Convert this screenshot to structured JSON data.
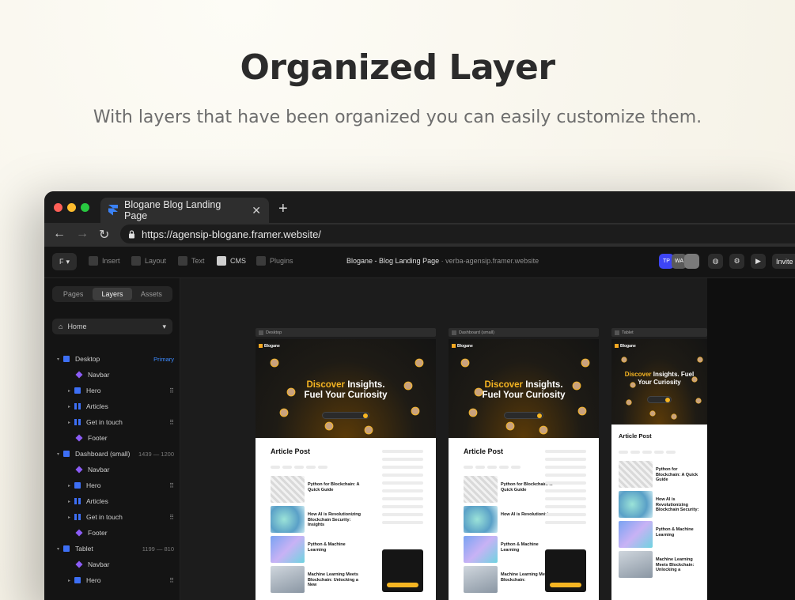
{
  "hero": {
    "title": "Organized Layer",
    "subtitle": "With layers that have been organized you can easily customize them."
  },
  "browser": {
    "tab_title": "Blogane Blog Landing Page",
    "url": "https://agensip-blogane.framer.website/",
    "traffic_colors": [
      "#fe5f57",
      "#febc2e",
      "#28c840"
    ]
  },
  "framer": {
    "toolbar": {
      "insert": "Insert",
      "layout": "Layout",
      "text": "Text",
      "cms": "CMS",
      "plugins": "Plugins"
    },
    "project_title": "Blogane - Blog Landing Page",
    "project_sub": "verba-agensip.framer.website",
    "avatars": [
      "TP",
      "WA"
    ],
    "invite": "Invite",
    "accent": "#3d45f5"
  },
  "sidebar": {
    "tabs": [
      "Pages",
      "Layers",
      "Assets"
    ],
    "active_tab": "Layers",
    "page_select": "Home",
    "layers": [
      {
        "name": "Desktop",
        "meta": "Primary",
        "type": "frame",
        "expanded": true
      },
      {
        "name": "Navbar",
        "type": "comp"
      },
      {
        "name": "Hero",
        "type": "frame",
        "grid": true
      },
      {
        "name": "Articles",
        "type": "stack"
      },
      {
        "name": "Get in touch",
        "type": "stack",
        "grid": true
      },
      {
        "name": "Footer",
        "type": "comp"
      },
      {
        "name": "Dashboard (small)",
        "meta": "1439 — 1200",
        "type": "frame",
        "expanded": true
      },
      {
        "name": "Navbar",
        "type": "comp"
      },
      {
        "name": "Hero",
        "type": "frame",
        "grid": true
      },
      {
        "name": "Articles",
        "type": "stack"
      },
      {
        "name": "Get in touch",
        "type": "stack",
        "grid": true
      },
      {
        "name": "Footer",
        "type": "comp"
      },
      {
        "name": "Tablet",
        "meta": "1199 — 810",
        "type": "frame",
        "expanded": true
      },
      {
        "name": "Navbar",
        "type": "comp"
      },
      {
        "name": "Hero",
        "type": "frame",
        "grid": true
      }
    ]
  },
  "canvas": {
    "frames": [
      {
        "label": "Desktop",
        "brand": "Blogane",
        "headline_accent": "Discover",
        "headline_1": " Insights.",
        "headline_2": "Fuel Your Curiosity",
        "section_title": "Article Post",
        "cards": [
          "Python for Blockchain: A Quick Guide",
          "How AI is Revolutionizing Blockchain Security: Insights",
          "Python & Machine Learning",
          "Machine Learning Meets Blockchain: Unlocking a New"
        ]
      },
      {
        "label": "Dashboard (small)",
        "brand": "Blogane",
        "headline_accent": "Discover",
        "headline_1": " Insights.",
        "headline_2": "Fuel Your Curiosity",
        "section_title": "Article Post",
        "cards": [
          "Python for Blockchain: A Quick Guide",
          "How AI is Revolutionizing",
          "Python & Machine Learning",
          "Machine Learning Meets Blockchain:"
        ]
      },
      {
        "label": "Tablet",
        "brand": "Blogane",
        "headline_accent": "Discover",
        "headline_1": " Insights. Fuel",
        "headline_2": "Your Curiosity",
        "section_title": "Article Post",
        "cards": [
          "Python for Blockchain: A Quick Guide",
          "How AI is Revolutionizing Blockchain Security:",
          "Python & Machine Learning",
          "Machine Learning Meets Blockchain: Unlocking a"
        ]
      }
    ]
  }
}
